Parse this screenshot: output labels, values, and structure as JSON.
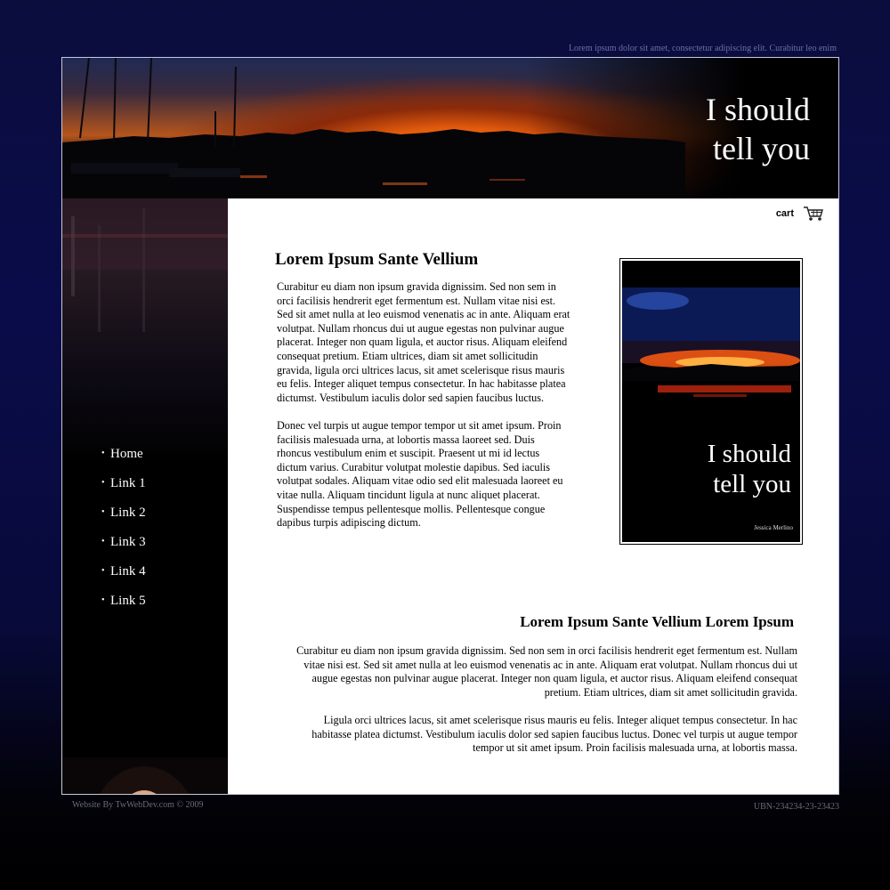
{
  "header": {
    "tagline": "Lorem ipsum dolor sit amet, consectetur adipiscing elit. Curabitur leo enim",
    "brand_line1": "I should",
    "brand_line2": "tell you"
  },
  "nav": {
    "items": [
      "Home",
      "Link 1",
      "Link 2",
      "Link 3",
      "Link 4",
      "Link 5"
    ]
  },
  "cart": {
    "label": "cart"
  },
  "section1": {
    "title": "Lorem Ipsum Sante Vellium",
    "paragraph1": "Curabitur eu diam non ipsum gravida dignissim. Sed non sem in orci facilisis hendrerit eget fermentum est. Nullam vitae nisi est. Sed sit amet nulla at leo euismod venenatis ac in ante. Aliquam erat volutpat. Nullam rhoncus dui ut augue egestas non pulvinar augue placerat. Integer non quam ligula, et auctor risus. Aliquam eleifend consequat pretium. Etiam ultrices, diam sit amet sollicitudin gravida, ligula orci ultrices lacus, sit amet scelerisque risus mauris eu felis. Integer aliquet tempus consectetur. In hac habitasse platea dictumst. Vestibulum iaculis dolor sed sapien faucibus luctus.",
    "paragraph2": "Donec vel turpis ut augue tempor tempor ut sit amet ipsum. Proin facilisis malesuada urna, at lobortis massa laoreet sed. Duis rhoncus vestibulum enim et suscipit. Praesent ut mi id lectus dictum varius. Curabitur volutpat molestie dapibus. Sed iaculis volutpat sodales. Aliquam vitae odio sed elit malesuada laoreet eu vitae nulla. Aliquam tincidunt ligula at nunc aliquet placerat. Suspendisse tempus pellentesque mollis. Pellentesque congue dapibus turpis adipiscing dictum."
  },
  "book": {
    "title_line1": "I should",
    "title_line2": "tell you",
    "author": "Jessica Merlino"
  },
  "section2": {
    "title": "Lorem Ipsum Sante Vellium Lorem Ipsum",
    "paragraph1": "Curabitur eu diam non ipsum gravida dignissim. Sed non sem in orci facilisis hendrerit eget fermentum est. Nullam vitae nisi est. Sed sit amet nulla at leo euismod venenatis ac in ante. Aliquam erat volutpat. Nullam rhoncus dui ut augue egestas non pulvinar augue placerat. Integer non quam ligula, et auctor risus. Aliquam eleifend consequat pretium. Etiam ultrices, diam sit amet sollicitudin gravida.",
    "paragraph2": "Ligula orci ultrices lacus, sit amet scelerisque risus mauris eu felis. Integer aliquet tempus consectetur. In hac habitasse platea dictumst. Vestibulum iaculis dolor sed sapien faucibus luctus. Donec vel turpis ut augue tempor tempor ut sit amet ipsum. Proin facilisis malesuada urna, at lobortis massa."
  },
  "footer": {
    "credit": "Website By TwWebDev.com  © 2009",
    "code": "UBN-234234-23-23423"
  },
  "icons": {
    "cart": "cart-icon",
    "bullet": "bullet-icon"
  },
  "colors": {
    "page_background": "#0a0c4a",
    "panel": "#ffffff",
    "sidebar": "#000000",
    "sunset_orange": "#ff8a14"
  }
}
